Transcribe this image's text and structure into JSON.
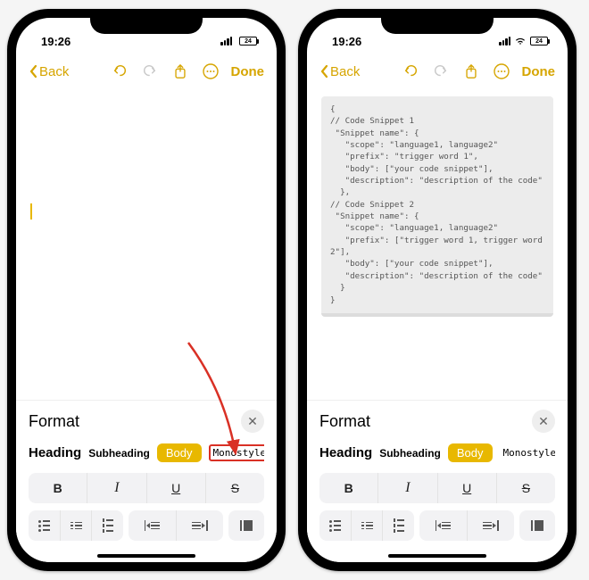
{
  "accent": "#d6a500",
  "statusbar": {
    "time": "19:26",
    "battery": "24"
  },
  "navbar": {
    "back": "Back",
    "done": "Done"
  },
  "format": {
    "title": "Format",
    "styles": {
      "heading": "Heading",
      "subheading": "Subheading",
      "body": "Body",
      "monostyled": "Monostyled"
    },
    "bold": "B",
    "italic": "I",
    "underline": "U",
    "strike": "S"
  },
  "codeSnippet": "{\n// Code Snippet 1\n \"Snippet name\": {\n   \"scope\": \"language1, language2\"\n   \"prefix\": \"trigger word 1\",\n   \"body\": [\"your code snippet\"],\n   \"description\": \"description of the code\"\n  },\n// Code Snippet 2\n \"Snippet name\": {\n   \"scope\": \"language1, language2\"\n   \"prefix\": [\"trigger word 1, trigger word 2\"],\n   \"body\": [\"your code snippet\"],\n   \"description\": \"description of the code\"\n  }\n}"
}
